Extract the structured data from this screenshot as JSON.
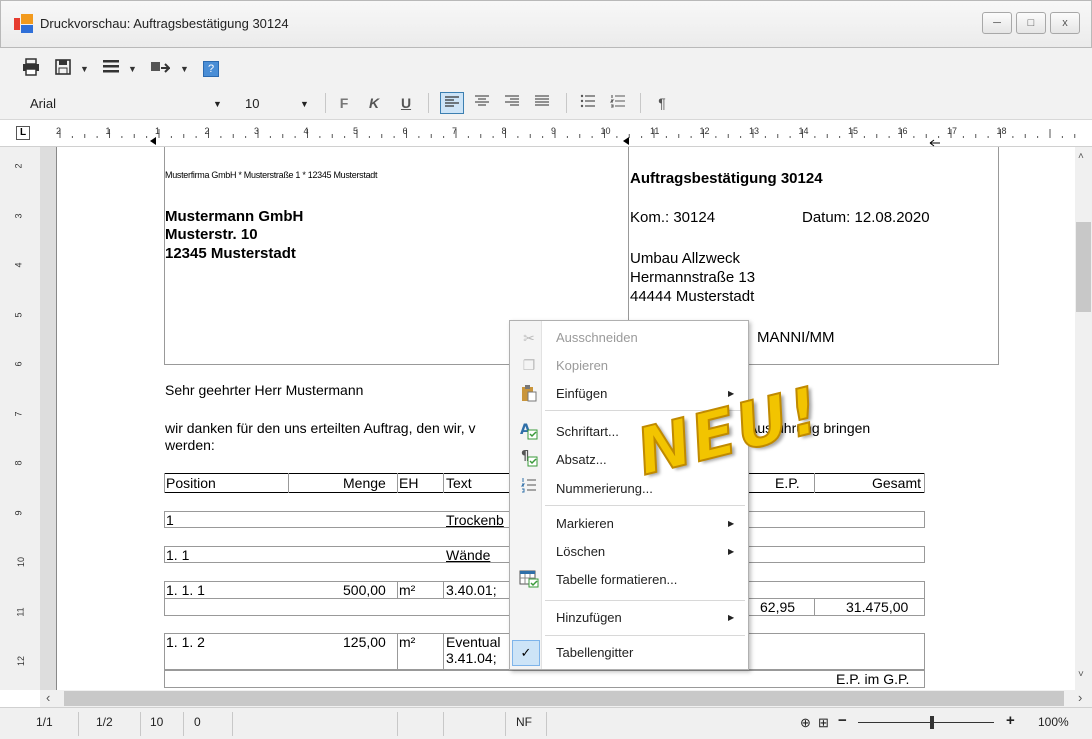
{
  "window": {
    "title": "Druckvorschau: Auftragsbestätigung 30124",
    "minimize": "─",
    "maximize": "□",
    "close": "x"
  },
  "toolbar": {
    "print_icon": "printer-icon",
    "save_icon": "save-icon",
    "menu_icon": "menu-icon",
    "send_icon": "send-icon",
    "help_icon": "help-icon"
  },
  "format": {
    "font": "Arial",
    "size": "10",
    "bold": "F",
    "italic": "K",
    "underline": "U",
    "pilcrow": "¶"
  },
  "ruler": {
    "h": [
      "2",
      "1",
      "1",
      "2",
      "3",
      "4",
      "5",
      "6",
      "7",
      "8",
      "9",
      "10",
      "11",
      "12",
      "13",
      "14",
      "15",
      "16",
      "17",
      "18"
    ],
    "v": [
      "2",
      "3",
      "4",
      "5",
      "6",
      "7",
      "8",
      "9",
      "10",
      "11",
      "12"
    ]
  },
  "doc": {
    "sender_line": "Musterfirma GmbH * Musterstraße 1 * 12345 Musterstadt",
    "recipient": [
      "Mustermann GmbH",
      "Musterstr. 10",
      "12345 Musterstadt"
    ],
    "heading": "Auftragsbestätigung 30124",
    "kom": "Kom.: 30124",
    "datum": "Datum: 12.08.2020",
    "project": [
      "Umbau Allzweck",
      "Hermannstraße 13",
      "44444 Musterstadt"
    ],
    "user": "MANNI/MM",
    "greeting": "Sehr geehrter Herr Mustermann",
    "body_1": "wir danken für den uns erteilten Auftrag, den wir, v",
    "body_1_end": "Ausführung bringen",
    "body_2": "werden:",
    "table_head": {
      "position": "Position",
      "menge": "Menge",
      "eh": "EH",
      "text": "Text",
      "ep": "E.P.",
      "gesamt": "Gesamt"
    },
    "rows": [
      {
        "position": "1",
        "text": "Trockenb"
      },
      {
        "position": "1. 1",
        "text": "Wände"
      },
      {
        "position": "1. 1.  1",
        "menge": "500,00",
        "eh": "m²",
        "text": "3.40.01; ",
        "ep": "62,95",
        "gesamt": "31.475,00"
      },
      {
        "position": "1. 1.  2",
        "menge": "125,00",
        "eh": "m²",
        "text": "Eventual",
        "text2": "3.41.04; "
      }
    ],
    "footer_cell": "E.P. im G.P."
  },
  "context_menu": {
    "items": [
      {
        "label": "Ausschneiden",
        "icon": "scissors-icon",
        "disabled": true
      },
      {
        "label": "Kopieren",
        "icon": "copy-icon",
        "disabled": true
      },
      {
        "label": "Einfügen",
        "icon": "paste-icon",
        "submenu": true
      },
      {
        "label": "Schriftart...",
        "icon": "font-icon"
      },
      {
        "label": "Absatz...",
        "icon": "paragraph-icon"
      },
      {
        "label": "Nummerierung...",
        "icon": "numbering-icon"
      },
      {
        "label": "Markieren",
        "submenu": true
      },
      {
        "label": "Löschen",
        "submenu": true
      },
      {
        "label": "Tabelle formatieren...",
        "icon": "table-format-icon"
      },
      {
        "label": "Hinzufügen",
        "submenu": true
      },
      {
        "label": "Tabellengitter",
        "checked": true
      }
    ]
  },
  "badge": "NEU!",
  "status": {
    "page": "1/1",
    "sheet": "1/2",
    "size": "10",
    "zero": "0",
    "mode": "NF",
    "zoom": "100%",
    "minus": "−",
    "plus": "+"
  }
}
